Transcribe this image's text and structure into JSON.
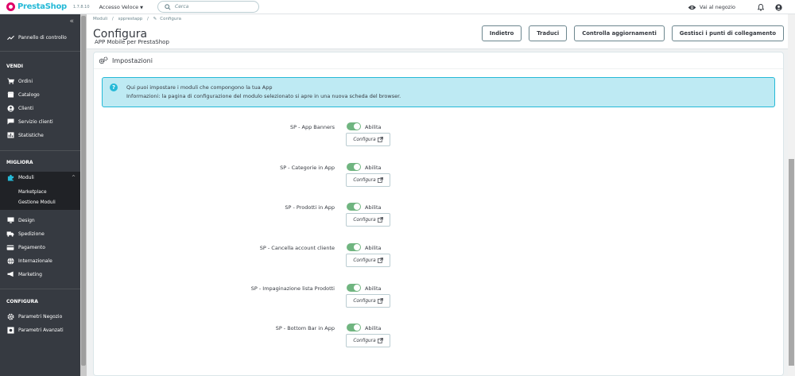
{
  "header": {
    "logo_text": "PrestaShop",
    "version": "1.7.8.10",
    "quick_access": "Accesso Veloce",
    "search_placeholder": "Cerca",
    "view_store": "Vai al negozio"
  },
  "sidebar": {
    "dashboard": "Pannello di controllo",
    "section_sell": "VENDI",
    "sell_items": [
      "Ordini",
      "Catalogo",
      "Clienti",
      "Servizio clienti",
      "Statistiche"
    ],
    "section_improve": "MIGLIORA",
    "modules": "Moduli",
    "modules_sub": [
      "Marketplace",
      "Gestione Moduli"
    ],
    "improve_items": [
      "Design",
      "Spedizione",
      "Pagamento",
      "Internazionale",
      "Marketing"
    ],
    "section_configure": "CONFIGURA",
    "configure_items": [
      "Parametri Negozio",
      "Parametri Avanzati"
    ]
  },
  "page": {
    "breadcrumb": [
      "Moduli",
      "/",
      "spprestapp",
      "/",
      "Configura"
    ],
    "title": "Configura",
    "subtitle": "APP Mobile per PrestaShop",
    "toolbar": [
      "Indietro",
      "Traduci",
      "Controlla aggiornamenti",
      "Gestisci i punti di collegamento"
    ]
  },
  "panel": {
    "title": "Impostazioni",
    "info_line1": "Qui puoi impostare i moduli che compongono la tua App",
    "info_line2": "Informazioni: la pagina di configurazione del modulo selezionato si apre in una nuova scheda del browser.",
    "enable_label": "Abilita",
    "configure_label": "Configura",
    "modules": [
      {
        "name": "SP - App Banners",
        "enabled": true
      },
      {
        "name": "SP - Categorie in App",
        "enabled": true
      },
      {
        "name": "SP - Prodotti in App",
        "enabled": true
      },
      {
        "name": "SP - Cancella account cliente",
        "enabled": true
      },
      {
        "name": "SP - Impaginazione lista Prodotti",
        "enabled": true
      },
      {
        "name": "SP - Bottom Bar in App",
        "enabled": true
      }
    ]
  },
  "colors": {
    "brand_pink": "#df0067",
    "brand_blue": "#25b9d7",
    "sidebar_bg": "#363a41",
    "toggle_on": "#70b580",
    "alert_bg": "#beeaf3"
  }
}
